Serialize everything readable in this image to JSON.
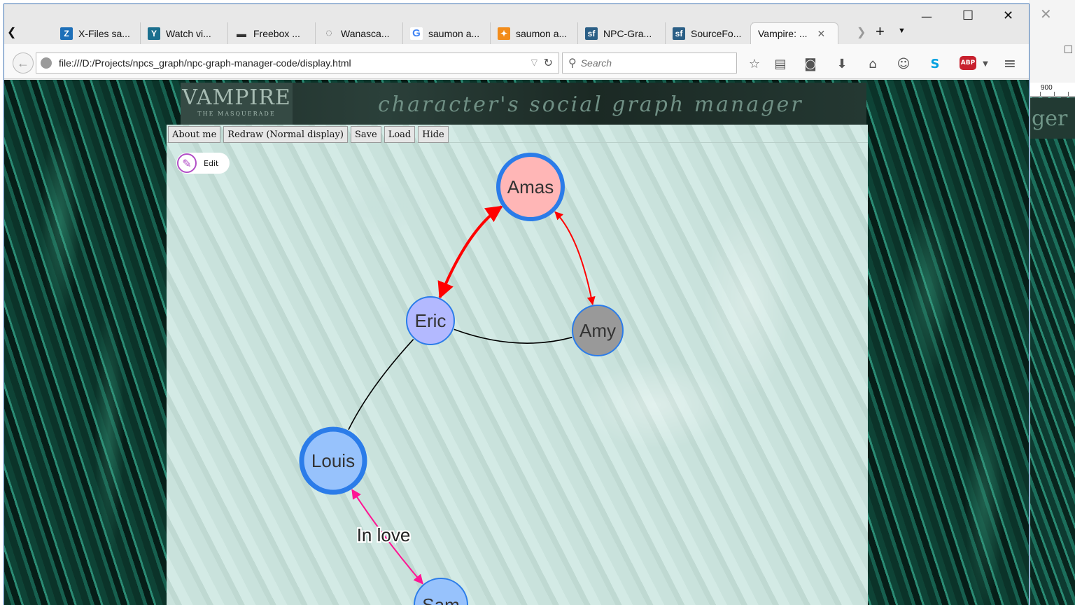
{
  "tabs": [
    {
      "label": "X-Files sa...",
      "icon": "zotero-icon",
      "color": "#1d6fb8",
      "glyph": "Z"
    },
    {
      "label": "Watch vi...",
      "icon": "yify-icon",
      "color": "#1b6f8e",
      "glyph": "Y"
    },
    {
      "label": "Freebox ...",
      "icon": "freebox-icon",
      "color": "#444444",
      "glyph": "▬"
    },
    {
      "label": "Wanasca...",
      "icon": "chat-bubble-icon",
      "color": "#dddddd",
      "glyph": "◌"
    },
    {
      "label": "saumon a...",
      "icon": "google-icon",
      "color": "#ffffff",
      "glyph": "G"
    },
    {
      "label": "saumon a...",
      "icon": "marmiton-icon",
      "color": "#f28c1b",
      "glyph": "✦"
    },
    {
      "label": "NPC-Gra...",
      "icon": "sourceforge-icon",
      "color": "#2b5f86",
      "glyph": "sf"
    },
    {
      "label": "SourceFo...",
      "icon": "sourceforge-icon",
      "color": "#2b5f86",
      "glyph": "sf"
    },
    {
      "label": "Vampire: ...",
      "icon": "",
      "color": "",
      "glyph": ""
    }
  ],
  "url": "file:///D:/Projects/npcs_graph/npc-graph-manager-code/display.html",
  "search": {
    "placeholder": "Search"
  },
  "banner": {
    "logo_text": "VAMPIRE",
    "logo_sub": "THE MASQUERADE",
    "title": "character's social graph manager"
  },
  "menu": [
    "About me",
    "Redraw (Normal display)",
    "Save",
    "Load",
    "Hide"
  ],
  "edit_label": "Edit",
  "colors": {
    "strong_edge": "#ff0000",
    "love_edge": "#ff1493",
    "neutral_edge": "#000000",
    "node_border": "#2b7ce9",
    "amas_fill": "#ffb6b6",
    "eric_fill": "#b3b9ff",
    "amy_fill": "#999999",
    "louis_fill": "#97c2fc",
    "sam_fill": "#97c2fc"
  },
  "graph": {
    "nodes": [
      {
        "id": "amas",
        "label": "Amas"
      },
      {
        "id": "eric",
        "label": "Eric"
      },
      {
        "id": "amy",
        "label": "Amy"
      },
      {
        "id": "louis",
        "label": "Louis"
      },
      {
        "id": "sam",
        "label": "Sam"
      }
    ],
    "edges": [
      {
        "from": "amas",
        "to": "eric",
        "label": "",
        "kind": "strong",
        "arrows": "both"
      },
      {
        "from": "amas",
        "to": "amy",
        "label": "",
        "kind": "strong",
        "arrows": "both"
      },
      {
        "from": "eric",
        "to": "amy",
        "label": "",
        "kind": "neutral",
        "arrows": "none"
      },
      {
        "from": "eric",
        "to": "louis",
        "label": "",
        "kind": "neutral",
        "arrows": "none"
      },
      {
        "from": "louis",
        "to": "sam",
        "label": "In love",
        "kind": "love",
        "arrows": "both"
      }
    ]
  }
}
